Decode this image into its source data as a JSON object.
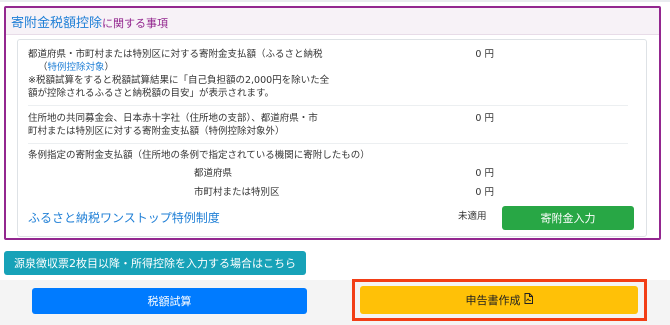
{
  "section": {
    "title": "寄附金税額控除",
    "title_suffix": "に関する事項"
  },
  "rows": {
    "furusato": {
      "label_line1": "都道府県・市町村または特別区に対する寄附金支払額（ふるさと納税",
      "link": "特例控除対象",
      "label_line2_prefix": "（",
      "label_line2_suffix": "）",
      "value": "0 円",
      "note_line1": "※税額試算をすると税額試算結果に「自己負担額の2,000円を除いた全",
      "note_line2": "額が控除されるふるさと納税額の目安」が表示されます。"
    },
    "community_chest": {
      "label_line1": "住所地の共同募金会、日本赤十字社（住所地の支部）、都道府県・市",
      "label_line2": "町村または特別区に対する寄附金支払額（特例控除対象外）",
      "value": "0 円"
    },
    "ordinance": {
      "label": "条例指定の寄附金支払額（住所地の条例で指定されている機関に寄附したもの）",
      "prefecture_label": "都道府県",
      "prefecture_value": "0 円",
      "municipality_label": "市町村または特別区",
      "municipality_value": "0 円"
    }
  },
  "one_stop": {
    "title": "ふるさと納税ワンストップ特例制度",
    "status": "未適用",
    "button": "寄附金入力"
  },
  "withholding_button": "源泉徴収票2枚目以降・所得控除を入力する場合はこちら",
  "footer": {
    "tax_calc_button": "税額試算",
    "create_return_button": "申告書作成",
    "create_return_icon": "pdf-document-icon"
  },
  "colors": {
    "accent_purple": "#93278f",
    "link_blue": "#1f7fd6",
    "green": "#28a745",
    "teal": "#17a2b8",
    "blue": "#007bff",
    "yellow": "#ffc107",
    "highlight_red": "#f23e16"
  }
}
